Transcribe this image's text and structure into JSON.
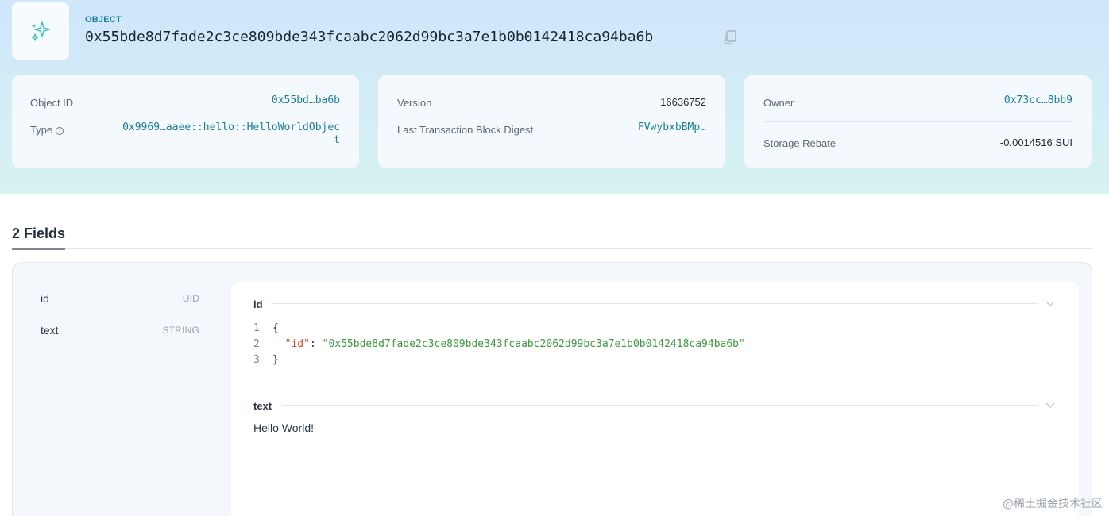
{
  "header": {
    "type_label": "OBJECT",
    "object_id": "0x55bde8d7fade2c3ce809bde343fcaabc2062d99bc3a7e1b0b0142418ca94ba6b"
  },
  "cards": {
    "object": {
      "object_id_label": "Object ID",
      "object_id_value": "0x55bd…ba6b",
      "type_label": "Type",
      "type_value_line1": "0x9969…aaee::hello::HelloWorldObjec",
      "type_value_line2": "t"
    },
    "version": {
      "version_label": "Version",
      "version_value": "16636752",
      "digest_label": "Last Transaction Block Digest",
      "digest_value": "FVwybxbBMp…"
    },
    "owner": {
      "owner_label": "Owner",
      "owner_value": "0x73cc…8bb9",
      "rebate_label": "Storage Rebate",
      "rebate_value": "-0.0014516 SUI"
    }
  },
  "fields": {
    "title": "2 Fields",
    "list": [
      {
        "name": "id",
        "type": "UID"
      },
      {
        "name": "text",
        "type": "STRING"
      }
    ],
    "sections": {
      "id": {
        "title": "id",
        "code": {
          "ln1": "1",
          "open": "{",
          "ln2": "2",
          "key": "\"id\"",
          "colon": ": ",
          "value": "\"0x55bde8d7fade2c3ce809bde343fcaabc2062d99bc3a7e1b0b0142418ca94ba6b\"",
          "ln3": "3",
          "close": "}"
        }
      },
      "text": {
        "title": "text",
        "value": "Hello World!"
      }
    }
  },
  "watermark": "@稀土掘金技术社区",
  "colors": {
    "accent": "#1a7d96",
    "json_key": "#d9482b",
    "json_string": "#3c9a3c"
  },
  "icons": {
    "object": "sparkle-icon",
    "copy": "copy-icon",
    "info": "info-icon",
    "collapse": "chevron-down-icon"
  }
}
